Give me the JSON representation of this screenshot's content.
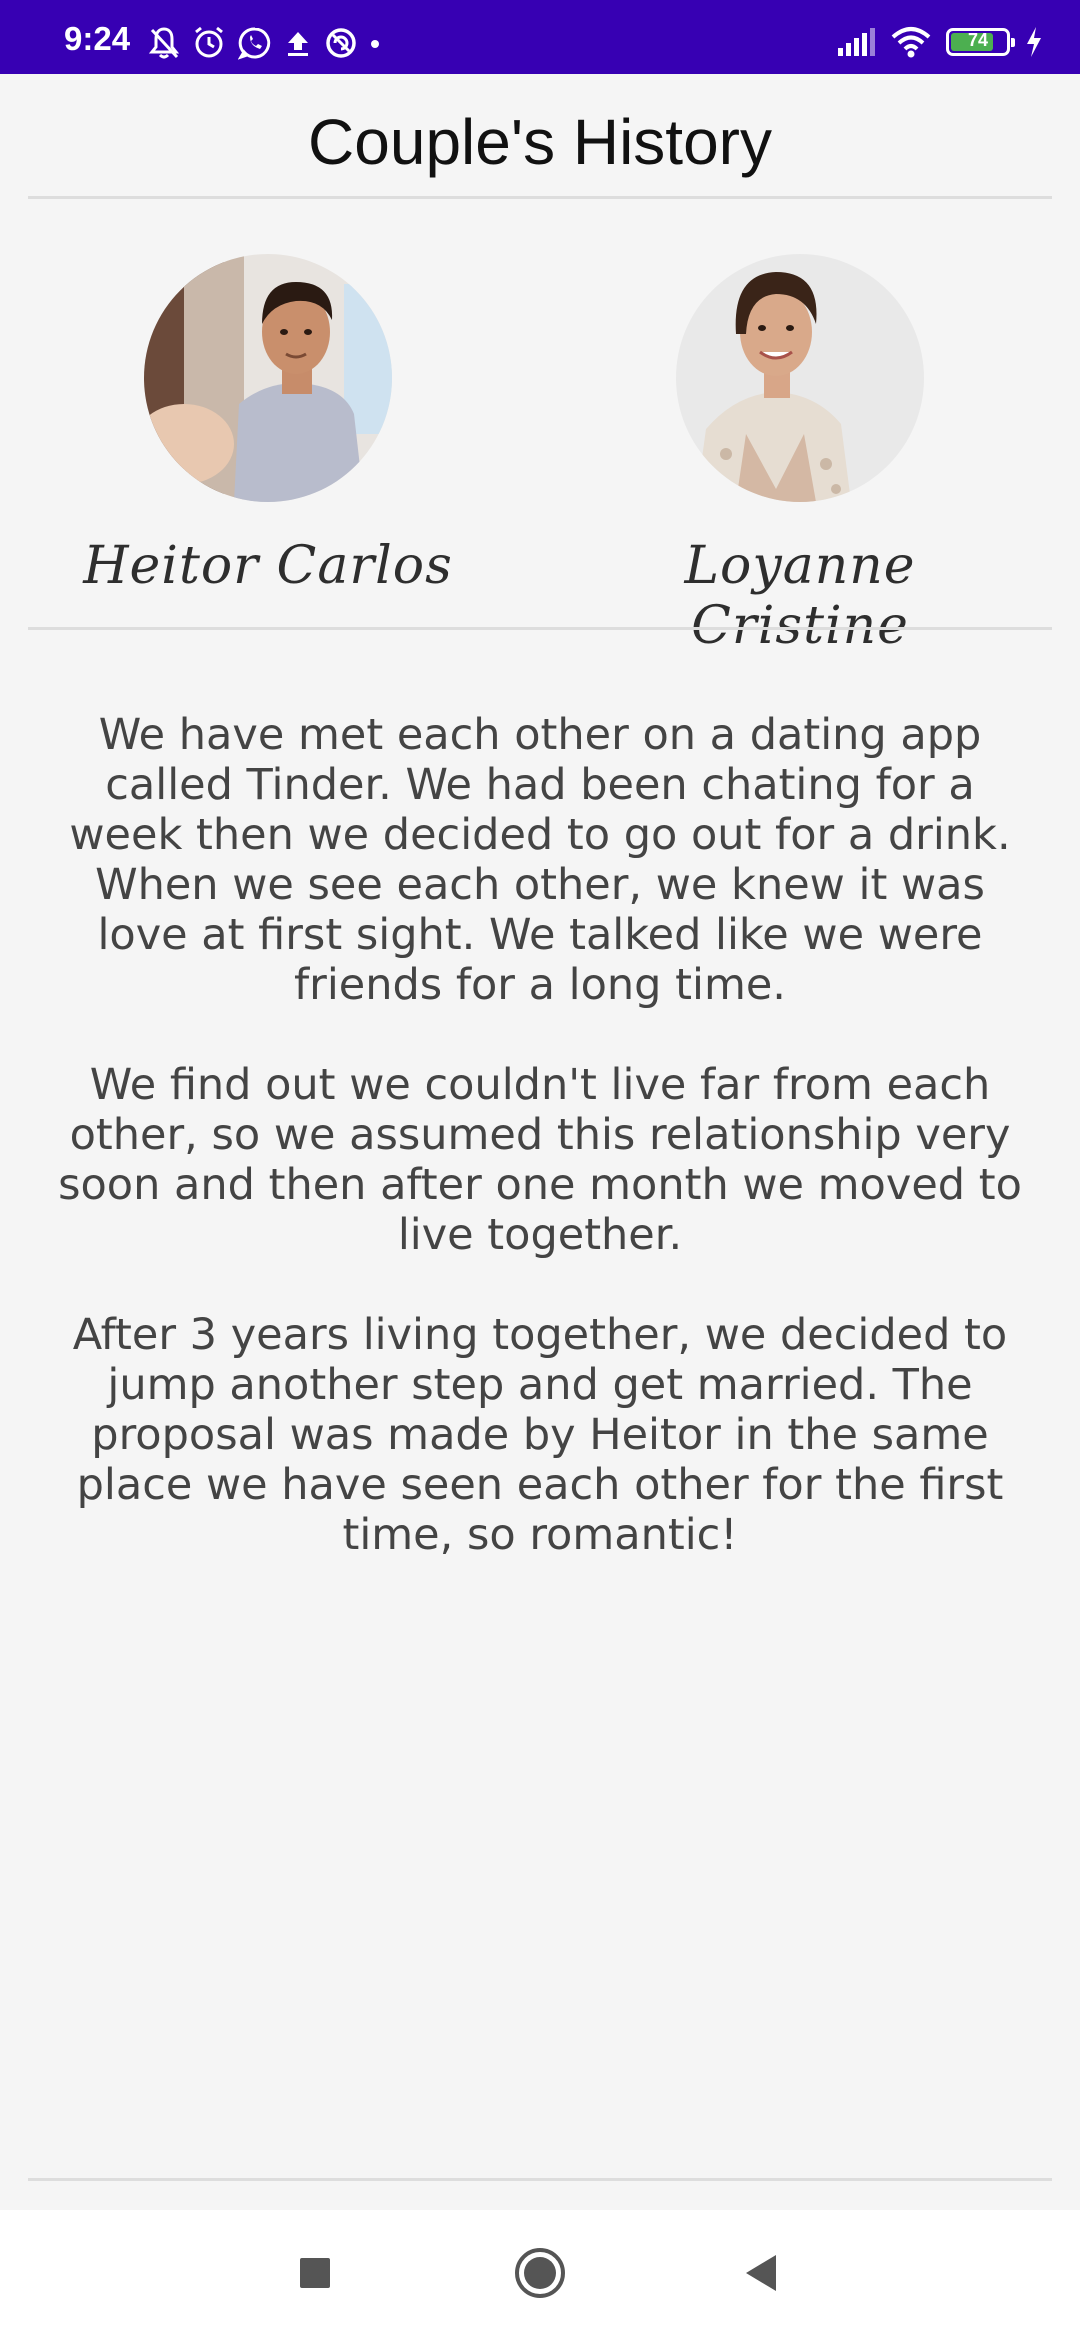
{
  "status_bar": {
    "time": "9:24",
    "battery_level": "74",
    "background_color": "#3700b3",
    "left_icons": [
      "bell-off-icon",
      "alarm-icon",
      "whatsapp-icon",
      "upload-icon",
      "data-saver-icon",
      "dot-icon"
    ],
    "right_icons": [
      "signal-icon",
      "wifi-icon",
      "battery-icon",
      "charging-icon"
    ]
  },
  "header": {
    "title": "Couple's History"
  },
  "couple": [
    {
      "name": "Heitor Carlos",
      "avatar": "photo-man"
    },
    {
      "name": "Loyanne Cristine",
      "avatar": "photo-woman"
    }
  ],
  "story": {
    "paragraphs": [
      "We have met each other on a dating app called Tinder. We had been chating for a week then we decided to go out for a drink. When we see each other, we knew it was love at first sight. We talked like we were friends for a long time.",
      "We find out we couldn't live far from each other, so we assumed this relationship very soon and then after one month we moved to live together.",
      "After 3 years living together, we decided to jump another step and get married. The proposal was made by Heitor in the same place we have seen each other for the first time, so romantic!"
    ]
  },
  "nav_bar": {
    "buttons": [
      "recents-square-icon",
      "home-circle-icon",
      "back-triangle-icon"
    ]
  }
}
